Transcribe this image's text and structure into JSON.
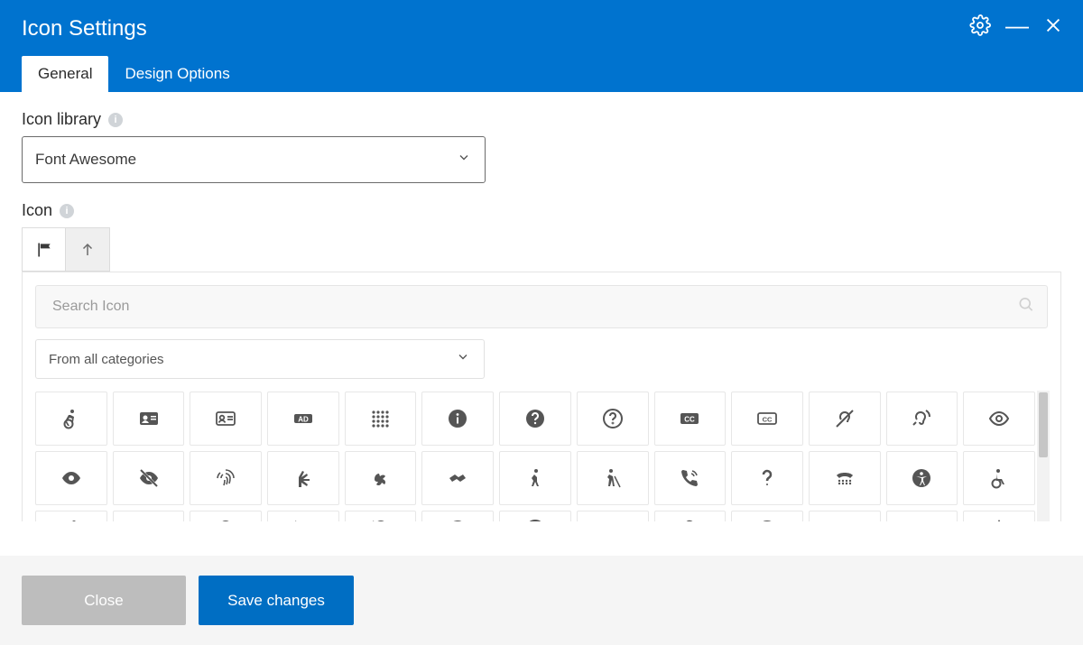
{
  "modal": {
    "title": "Icon Settings"
  },
  "tabs": {
    "general": "General",
    "design": "Design Options"
  },
  "fields": {
    "library_label": "Icon library",
    "library_value": "Font Awesome",
    "icon_label": "Icon",
    "search_placeholder": "Search Icon",
    "category_value": "From all categories"
  },
  "footer": {
    "close": "Close",
    "save": "Save changes"
  },
  "icons": {
    "row1": [
      "accessible-icon",
      "address-card-solid-icon",
      "address-card-icon",
      "audio-description-icon",
      "braille-icon",
      "info-circle-icon",
      "question-circle-solid-icon",
      "question-circle-icon",
      "closed-captioning-solid-icon",
      "closed-captioning-icon",
      "deaf-icon",
      "assistive-listening-icon",
      "eye-icon"
    ],
    "row2": [
      "eye-solid-icon",
      "eye-slash-icon",
      "fingerprint-icon",
      "sign-language-icon",
      "hands-asl-icon",
      "hands-helping-icon",
      "walking-icon",
      "blind-icon",
      "phone-volume-icon",
      "question-icon",
      "tty-icon",
      "universal-access-icon",
      "wheelchair-icon"
    ],
    "row3": [
      "running-icon",
      "bell-solid-icon",
      "bell-icon",
      "bell-slash-solid-icon",
      "bell-slash-icon",
      "exclamation-circle-icon",
      "radiation-alt-icon",
      "info-icon",
      "question-mark-icon",
      "radiation-icon",
      "skull-crossbones-icon",
      "exclamation-triangle-solid-icon",
      "exclamation-triangle-icon"
    ]
  }
}
